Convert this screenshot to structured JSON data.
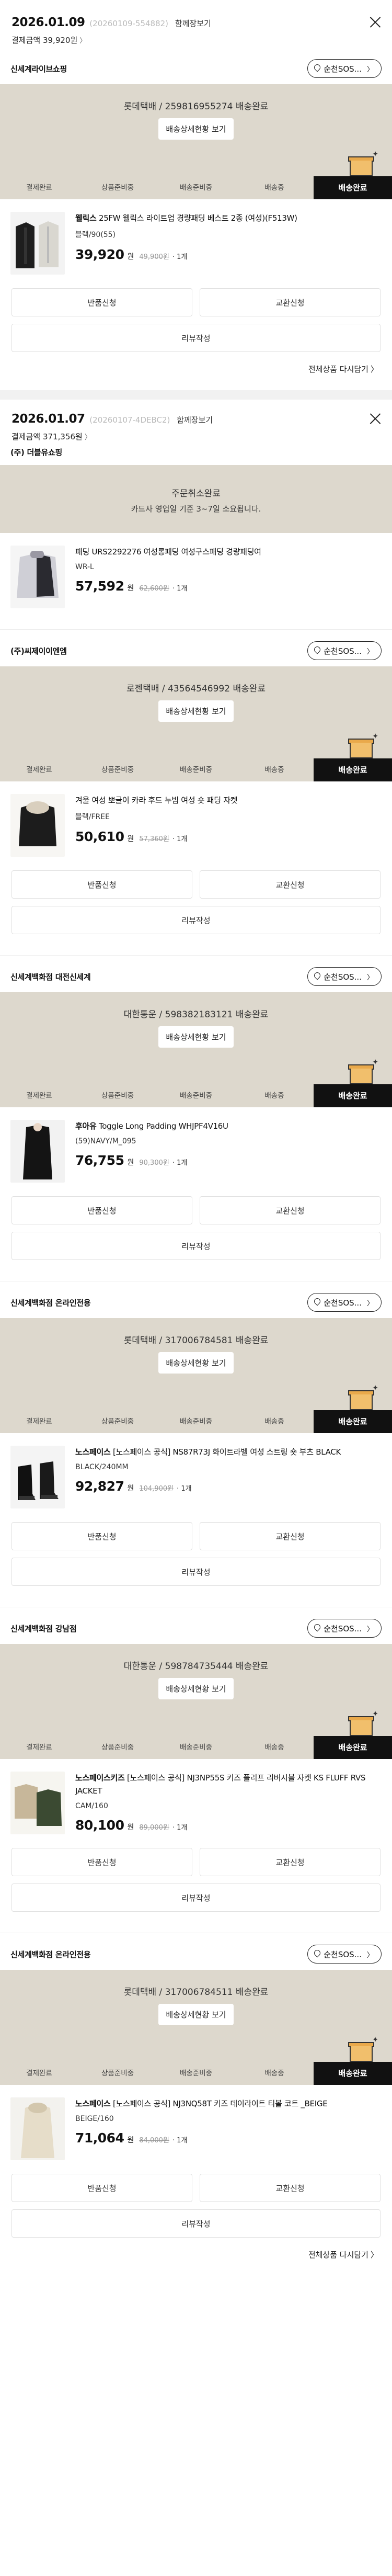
{
  "orders": [
    {
      "date": "2026.01.09",
      "order_no": "(20260109-554882)",
      "detail_label": "함께장보기",
      "payment": "결제금액 39,920원",
      "sellers": [
        {
          "name": "신세계라이브쇼핑",
          "pill": "순천SOS...",
          "status": "롯데택배 / 259816955274 배송완료",
          "status_btn": "배송상세현황 보기",
          "steps": [
            "결제완료",
            "상품준비중",
            "배송준비중",
            "배송중",
            "배송완료"
          ],
          "item": {
            "brand": "웰릭스",
            "name": "25FW 웰릭스 라이트업 경량패딩 베스트 2종 (여성)(F513W)",
            "option": "블랙/90(55)",
            "price": "39,920",
            "won": "원",
            "orig": "49,900원",
            "qty": "· 1개"
          },
          "buttons": [
            "반품신청",
            "교환신청"
          ],
          "review": "리뷰작성"
        }
      ],
      "more_link": "전체상품 다시담기"
    },
    {
      "date": "2026.01.07",
      "order_no": "(20260107-4DEBC2)",
      "detail_label": "함께장보기",
      "payment": "결제금액 371,356원",
      "sellers": [
        {
          "name": "(주) 더블유쇼핑",
          "cancel_title": "주문취소완료",
          "cancel_sub": "카드사 영업일 기준 3~7일 소요됩니다.",
          "item": {
            "brand": "",
            "name": "패딩 URS2292276 여성롱패딩 여성구스패딩 경량패딩여",
            "option": "WR-L",
            "price": "57,592",
            "won": "원",
            "orig": "62,600원",
            "qty": "· 1개"
          }
        },
        {
          "name": "(주)씨제이이엔엠",
          "pill": "순천SOS...",
          "status": "로젠택배 / 43564546992 배송완료",
          "status_btn": "배송상세현황 보기",
          "steps": [
            "결제완료",
            "상품준비중",
            "배송준비중",
            "배송중",
            "배송완료"
          ],
          "item": {
            "brand": "",
            "name": "겨울 여성 뽀글이 카라 후드 누빔 여성 숏 패딩 자켓",
            "option": "블랙/FREE",
            "price": "50,610",
            "won": "원",
            "orig": "57,360원",
            "qty": "· 1개"
          },
          "buttons": [
            "반품신청",
            "교환신청"
          ],
          "review": "리뷰작성"
        },
        {
          "name": "신세계백화점 대전신세계",
          "pill": "순천SOS...",
          "status": "대한통운 / 598382183121 배송완료",
          "status_btn": "배송상세현황 보기",
          "steps": [
            "결제완료",
            "상품준비중",
            "배송준비중",
            "배송중",
            "배송완료"
          ],
          "item": {
            "brand": "후아유",
            "name": "Toggle Long Padding WHJPF4V16U",
            "option": "(59)NAVY/M_095",
            "price": "76,755",
            "won": "원",
            "orig": "90,300원",
            "qty": "· 1개"
          },
          "buttons": [
            "반품신청",
            "교환신청"
          ],
          "review": "리뷰작성"
        },
        {
          "name": "신세계백화점 온라인전용",
          "pill": "순천SOS...",
          "status": "롯데택배 / 317006784581 배송완료",
          "status_btn": "배송상세현황 보기",
          "steps": [
            "결제완료",
            "상품준비중",
            "배송준비중",
            "배송중",
            "배송완료"
          ],
          "item": {
            "brand": "노스페이스",
            "name": "[노스페이스 공식] NS87R73J 화이트라벨 여성 스트링 숏 부츠 BLACK",
            "option": "BLACK/240MM",
            "price": "92,827",
            "won": "원",
            "orig": "104,900원",
            "qty": "· 1개"
          },
          "buttons": [
            "반품신청",
            "교환신청"
          ],
          "review": "리뷰작성"
        },
        {
          "name": "신세계백화점 강남점",
          "pill": "순천SOS...",
          "status": "대한통운 / 598784735444 배송완료",
          "status_btn": "배송상세현황 보기",
          "steps": [
            "결제완료",
            "상품준비중",
            "배송준비중",
            "배송중",
            "배송완료"
          ],
          "item": {
            "brand": "노스페이스키즈",
            "name": "[노스페이스 공식] NJ3NP55S 키즈 플리프 리버시블 자켓 KS FLUFF RVS JACKET",
            "option": "CAM/160",
            "price": "80,100",
            "won": "원",
            "orig": "89,000원",
            "qty": "· 1개"
          },
          "buttons": [
            "반품신청",
            "교환신청"
          ],
          "review": "리뷰작성"
        },
        {
          "name": "신세계백화점 온라인전용",
          "pill": "순천SOS...",
          "status": "롯데택배 / 317006784511 배송완료",
          "status_btn": "배송상세현황 보기",
          "steps": [
            "결제완료",
            "상품준비중",
            "배송준비중",
            "배송중",
            "배송완료"
          ],
          "item": {
            "brand": "노스페이스",
            "name": "[노스페이스 공식] NJ3NQ58T 키즈 데이라이트 티볼 코트 _BEIGE",
            "option": "BEIGE/160",
            "price": "71,064",
            "won": "원",
            "orig": "84,000원",
            "qty": "· 1개"
          },
          "buttons": [
            "반품신청",
            "교환신청"
          ],
          "review": "리뷰작성"
        }
      ],
      "more_link": "전체상품 다시담기"
    }
  ]
}
